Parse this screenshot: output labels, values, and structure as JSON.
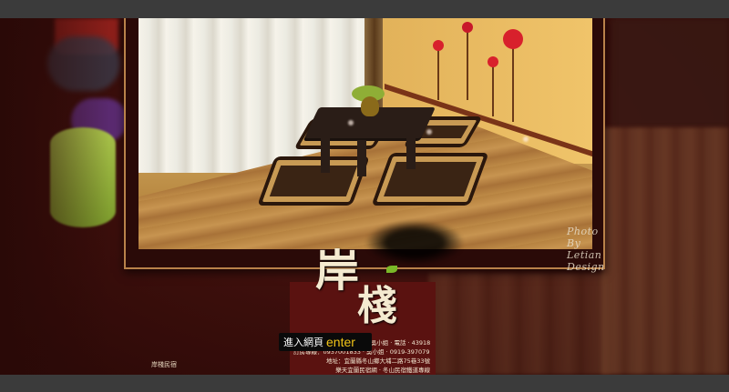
{
  "photo": {
    "watermark": "Photo By Letian Design"
  },
  "logo": {
    "char1": "岸",
    "char2": "棧"
  },
  "enter": {
    "zh_label": "進入網頁",
    "en_label": "enter"
  },
  "info": {
    "line1": "訂房專線：0937-001-833 · 吳小姐 · 電話 · 43918",
    "line2": "訂房專線：0937001833 · 吳小姐 · 0919-397079 · 杜小姐",
    "line3": "地址：宜蘭縣冬山鄉大埔二路75巷33號",
    "line4": "樂天宜蘭民宿網 · 冬山民宿鐵道專線"
  },
  "footer": {
    "site_name": "岸棧民宿"
  },
  "colors": {
    "background": "#3d0f0c",
    "frame": "#b9824a",
    "enter_text": "#f2c418"
  }
}
